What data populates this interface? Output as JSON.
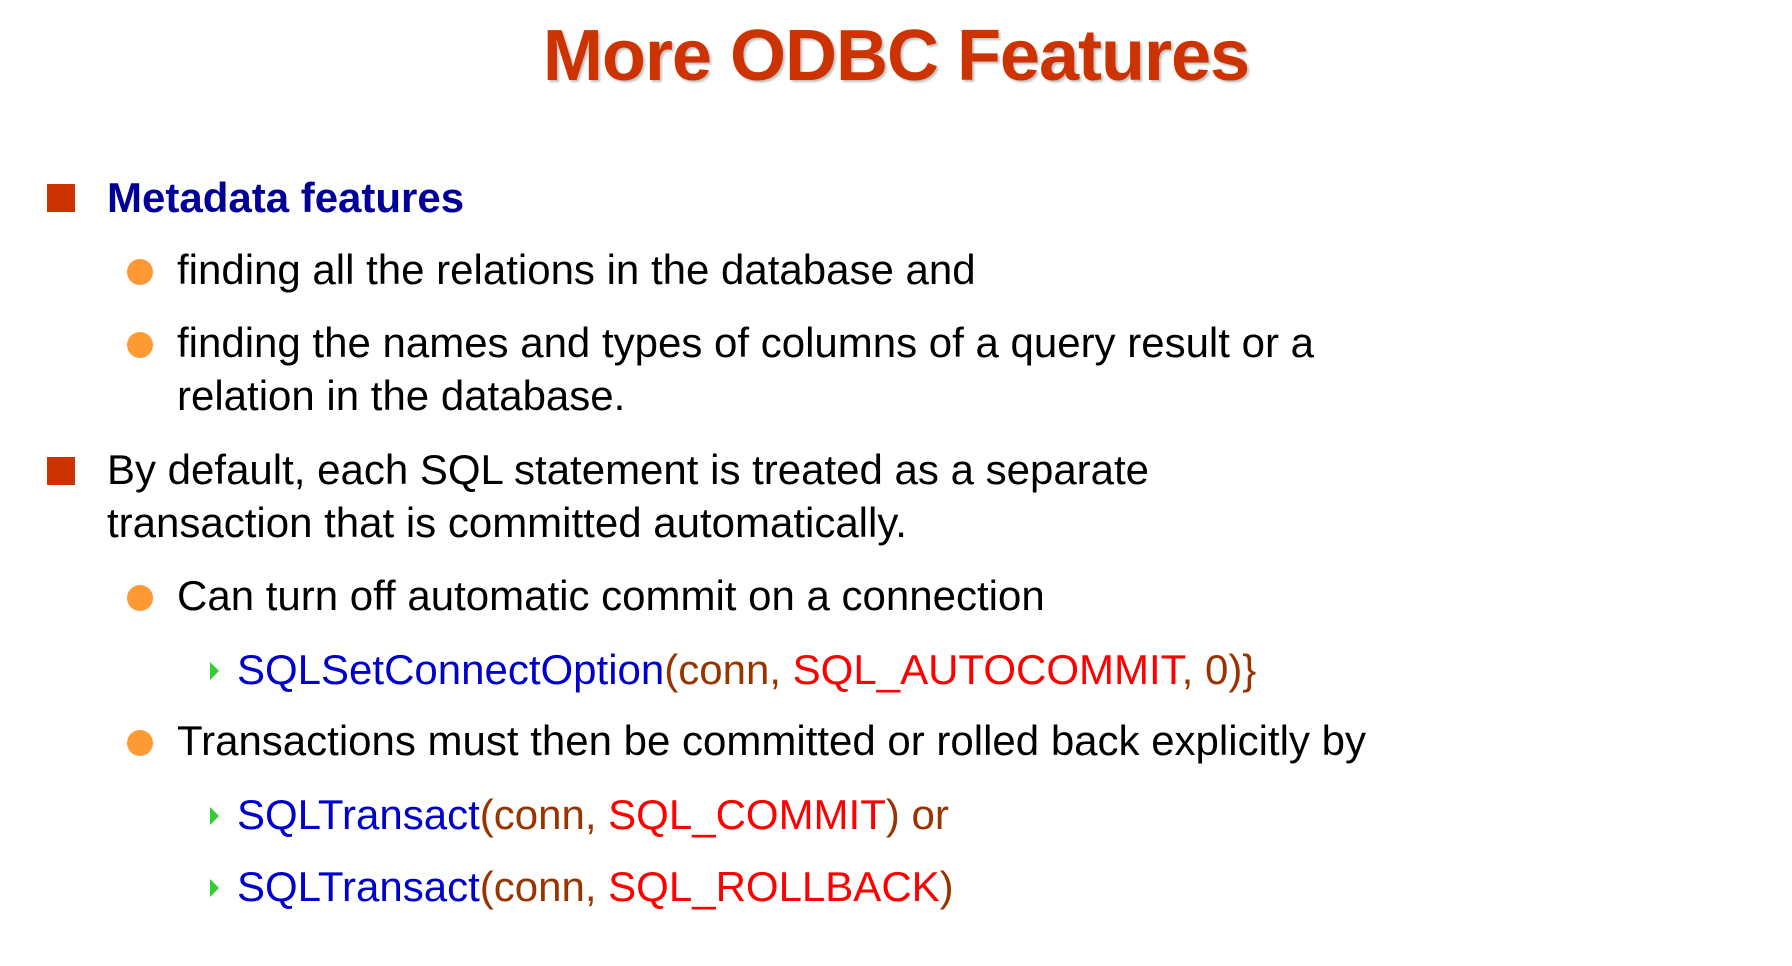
{
  "title": "More ODBC Features",
  "colors": {
    "title": "#cc3300",
    "square_bullet": "#cc3300",
    "circle_bullet": "#ff9933",
    "arrow_bullet": "#33cc33",
    "function": "#0000cc",
    "argument": "#993300",
    "constant": "#ff0000",
    "heading": "#000099"
  },
  "items": {
    "metadata": {
      "heading": "Metadata features",
      "sub1": "finding all the relations in the database and",
      "sub2_line1": "finding the names and types of columns of a query result or a",
      "sub2_line2": "relation in the database."
    },
    "autocommit": {
      "line1": "By default, each SQL statement is treated as a separate",
      "line2": "transaction that is committed automatically.",
      "sub1": "Can turn off automatic commit on a connection",
      "code1": {
        "fn": "SQLSetConnectOption",
        "open": "(conn, ",
        "const": "SQL_AUTOCOMMIT",
        "close": ", 0)}"
      },
      "sub2": "Transactions must then be committed or rolled back explicitly by",
      "code2": {
        "fn": "SQLTransact",
        "open": "(conn, ",
        "const": "SQL_COMMIT",
        "close": ") or"
      },
      "code3": {
        "fn": "SQLTransact",
        "open": "(conn, ",
        "const": "SQL_ROLLBACK",
        "close": ")"
      }
    }
  }
}
